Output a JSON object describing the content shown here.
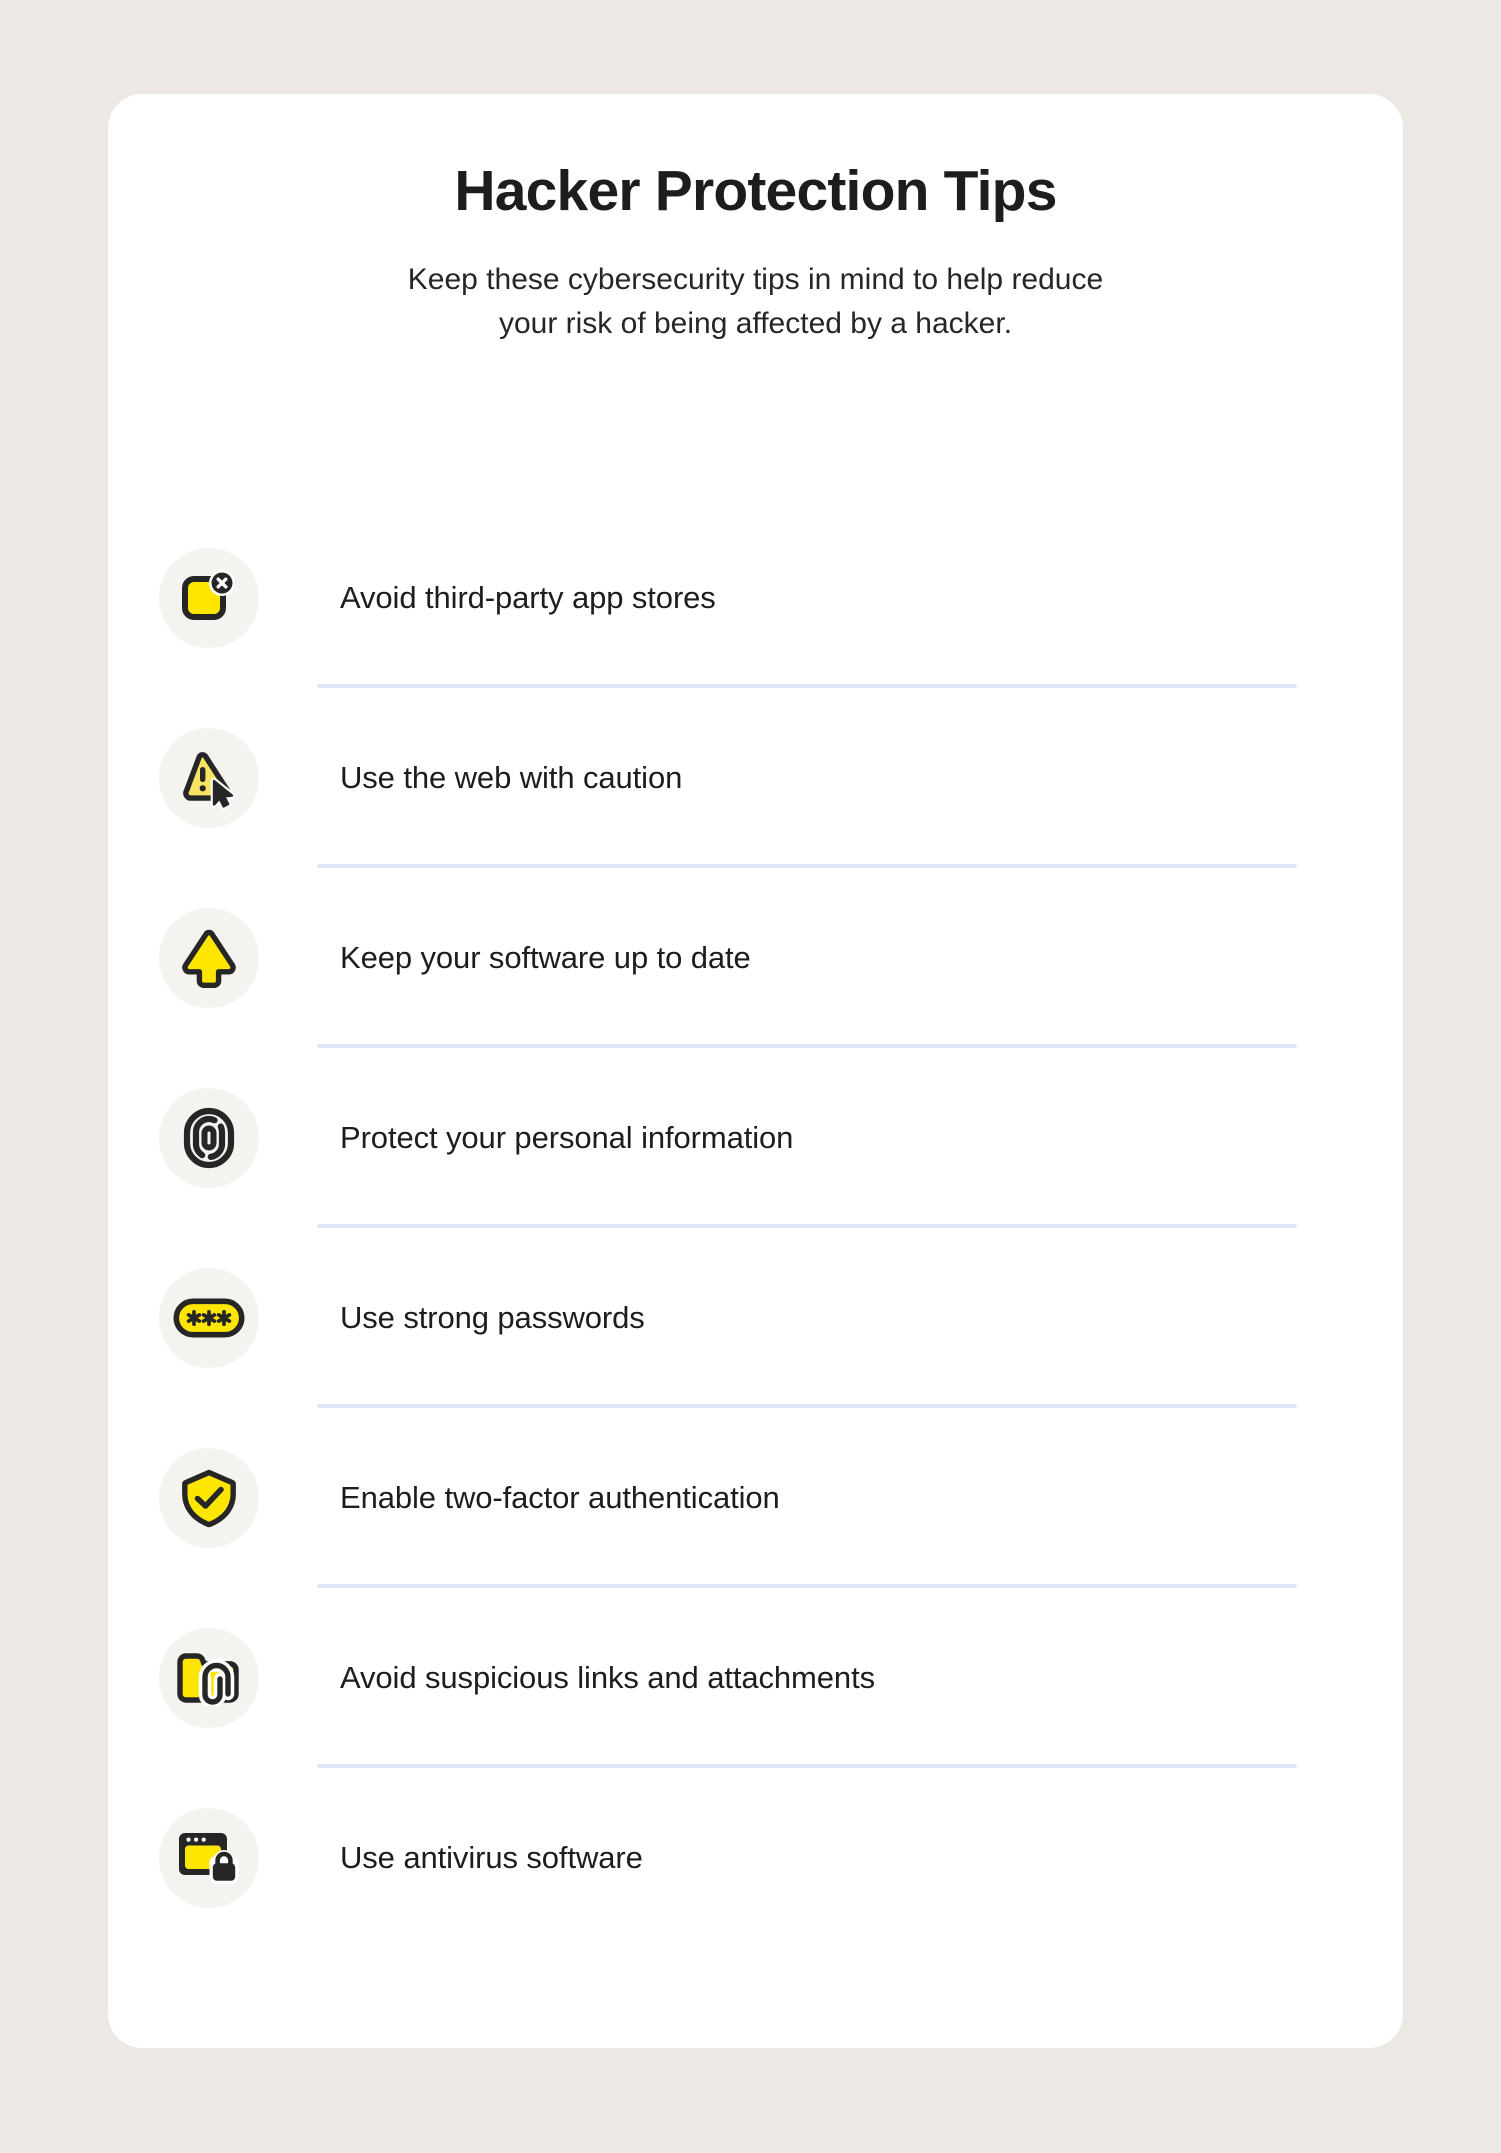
{
  "theme": {
    "page_background": "#ece9e4",
    "card_background": "#ffffff",
    "accent_yellow": "#ffe600",
    "accent_yellow_soft": "#f7e463",
    "ink": "#1d1d1d",
    "icon_badge_background": "#f4f3f0",
    "divider": "#dde7f8"
  },
  "header": {
    "title": "Hacker Protection Tips",
    "subtitle": "Keep these cybersecurity tips in mind to help reduce your risk of being affected by a hacker."
  },
  "tips": [
    {
      "icon": "app-window-blocked-icon",
      "label": "Avoid third-party app stores"
    },
    {
      "icon": "warning-cursor-icon",
      "label": "Use the web with caution"
    },
    {
      "icon": "up-arrow-icon",
      "label": "Keep your software up to date"
    },
    {
      "icon": "fingerprint-icon",
      "label": "Protect your personal information"
    },
    {
      "icon": "password-asterisks-icon",
      "label": "Use strong passwords"
    },
    {
      "icon": "shield-check-icon",
      "label": "Enable two-factor authentication"
    },
    {
      "icon": "folder-paperclip-icon",
      "label": "Avoid suspicious links and attachments"
    },
    {
      "icon": "browser-lock-icon",
      "label": "Use antivirus software"
    }
  ]
}
